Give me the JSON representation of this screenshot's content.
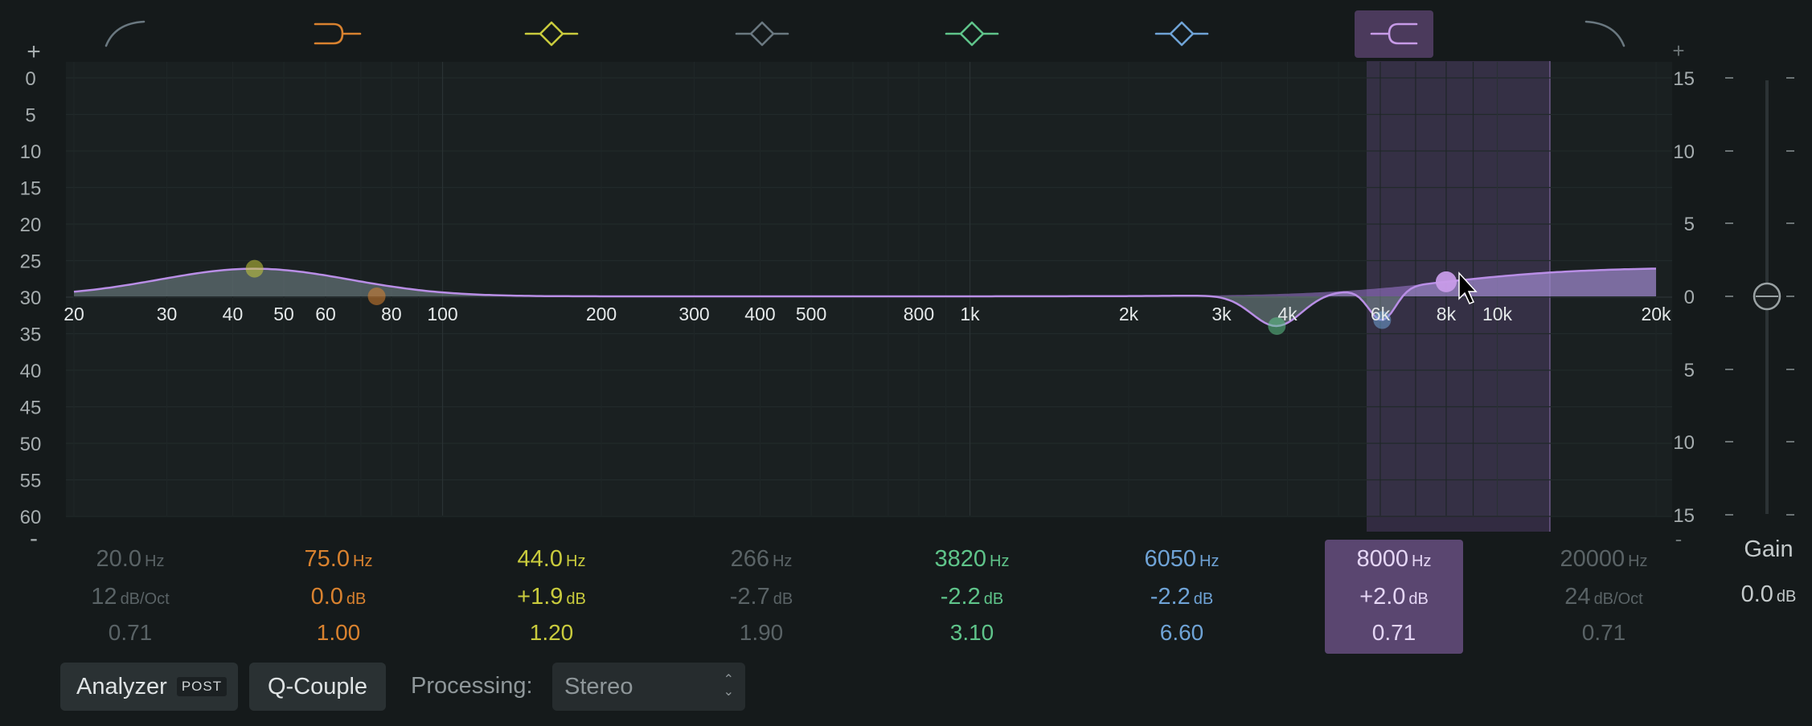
{
  "left_scale": {
    "plus": "+",
    "minus": "-",
    "labels": [
      "0",
      "5",
      "10",
      "15",
      "20",
      "25",
      "30",
      "35",
      "40",
      "45",
      "50",
      "55",
      "60"
    ]
  },
  "right_scale": {
    "plus": "+",
    "minus": "-",
    "labels": [
      "15",
      "10",
      "5",
      "0",
      "5",
      "10",
      "15"
    ]
  },
  "freq_labels": [
    "20",
    "30",
    "40",
    "50",
    "60",
    "80",
    "100",
    "200",
    "300",
    "400",
    "500",
    "800",
    "1k",
    "2k",
    "3k",
    "4k",
    "6k",
    "8k",
    "10k",
    "20k"
  ],
  "bands": [
    {
      "type": "low-cut-icon",
      "color": "#6a7880",
      "freq": "20.0",
      "freq_unit": "Hz",
      "gain": "12",
      "gain_unit": "dB/Oct",
      "q": "0.71",
      "active": false,
      "selected": false
    },
    {
      "type": "low-shelf-icon",
      "color": "#d9822f",
      "freq": "75.0",
      "freq_unit": "Hz",
      "gain": "0.0",
      "gain_unit": "dB",
      "q": "1.00",
      "active": true,
      "selected": false
    },
    {
      "type": "bell-icon",
      "color": "#c9cb3d",
      "freq": "44.0",
      "freq_unit": "Hz",
      "gain": "+1.9",
      "gain_unit": "dB",
      "q": "1.20",
      "active": true,
      "selected": false
    },
    {
      "type": "bell-icon",
      "color": "#6a7880",
      "freq": "266",
      "freq_unit": "Hz",
      "gain": "-2.7",
      "gain_unit": "dB",
      "q": "1.90",
      "active": false,
      "selected": false
    },
    {
      "type": "bell-icon",
      "color": "#5fc48a",
      "freq": "3820",
      "freq_unit": "Hz",
      "gain": "-2.2",
      "gain_unit": "dB",
      "q": "3.10",
      "active": true,
      "selected": false
    },
    {
      "type": "bell-icon",
      "color": "#6fa3d6",
      "freq": "6050",
      "freq_unit": "Hz",
      "gain": "-2.2",
      "gain_unit": "dB",
      "q": "6.60",
      "active": true,
      "selected": false
    },
    {
      "type": "high-shelf-icon",
      "color": "#c79be8",
      "freq": "8000",
      "freq_unit": "Hz",
      "gain": "+2.0",
      "gain_unit": "dB",
      "q": "0.71",
      "active": true,
      "selected": true
    },
    {
      "type": "high-cut-icon",
      "color": "#6a7880",
      "freq": "20000",
      "freq_unit": "Hz",
      "gain": "24",
      "gain_unit": "dB/Oct",
      "q": "0.71",
      "active": false,
      "selected": false
    }
  ],
  "gain": {
    "label": "Gain",
    "value": "0.0",
    "unit": "dB",
    "level_db": 0
  },
  "bottom": {
    "analyzer_label": "Analyzer",
    "analyzer_badge": "POST",
    "qcouple_label": "Q-Couple",
    "processing_label": "Processing:",
    "processing_value": "Stereo"
  },
  "colors": {
    "curve": "#b98ee6",
    "selection": "#9a6fcf",
    "background": "#151a1b"
  }
}
